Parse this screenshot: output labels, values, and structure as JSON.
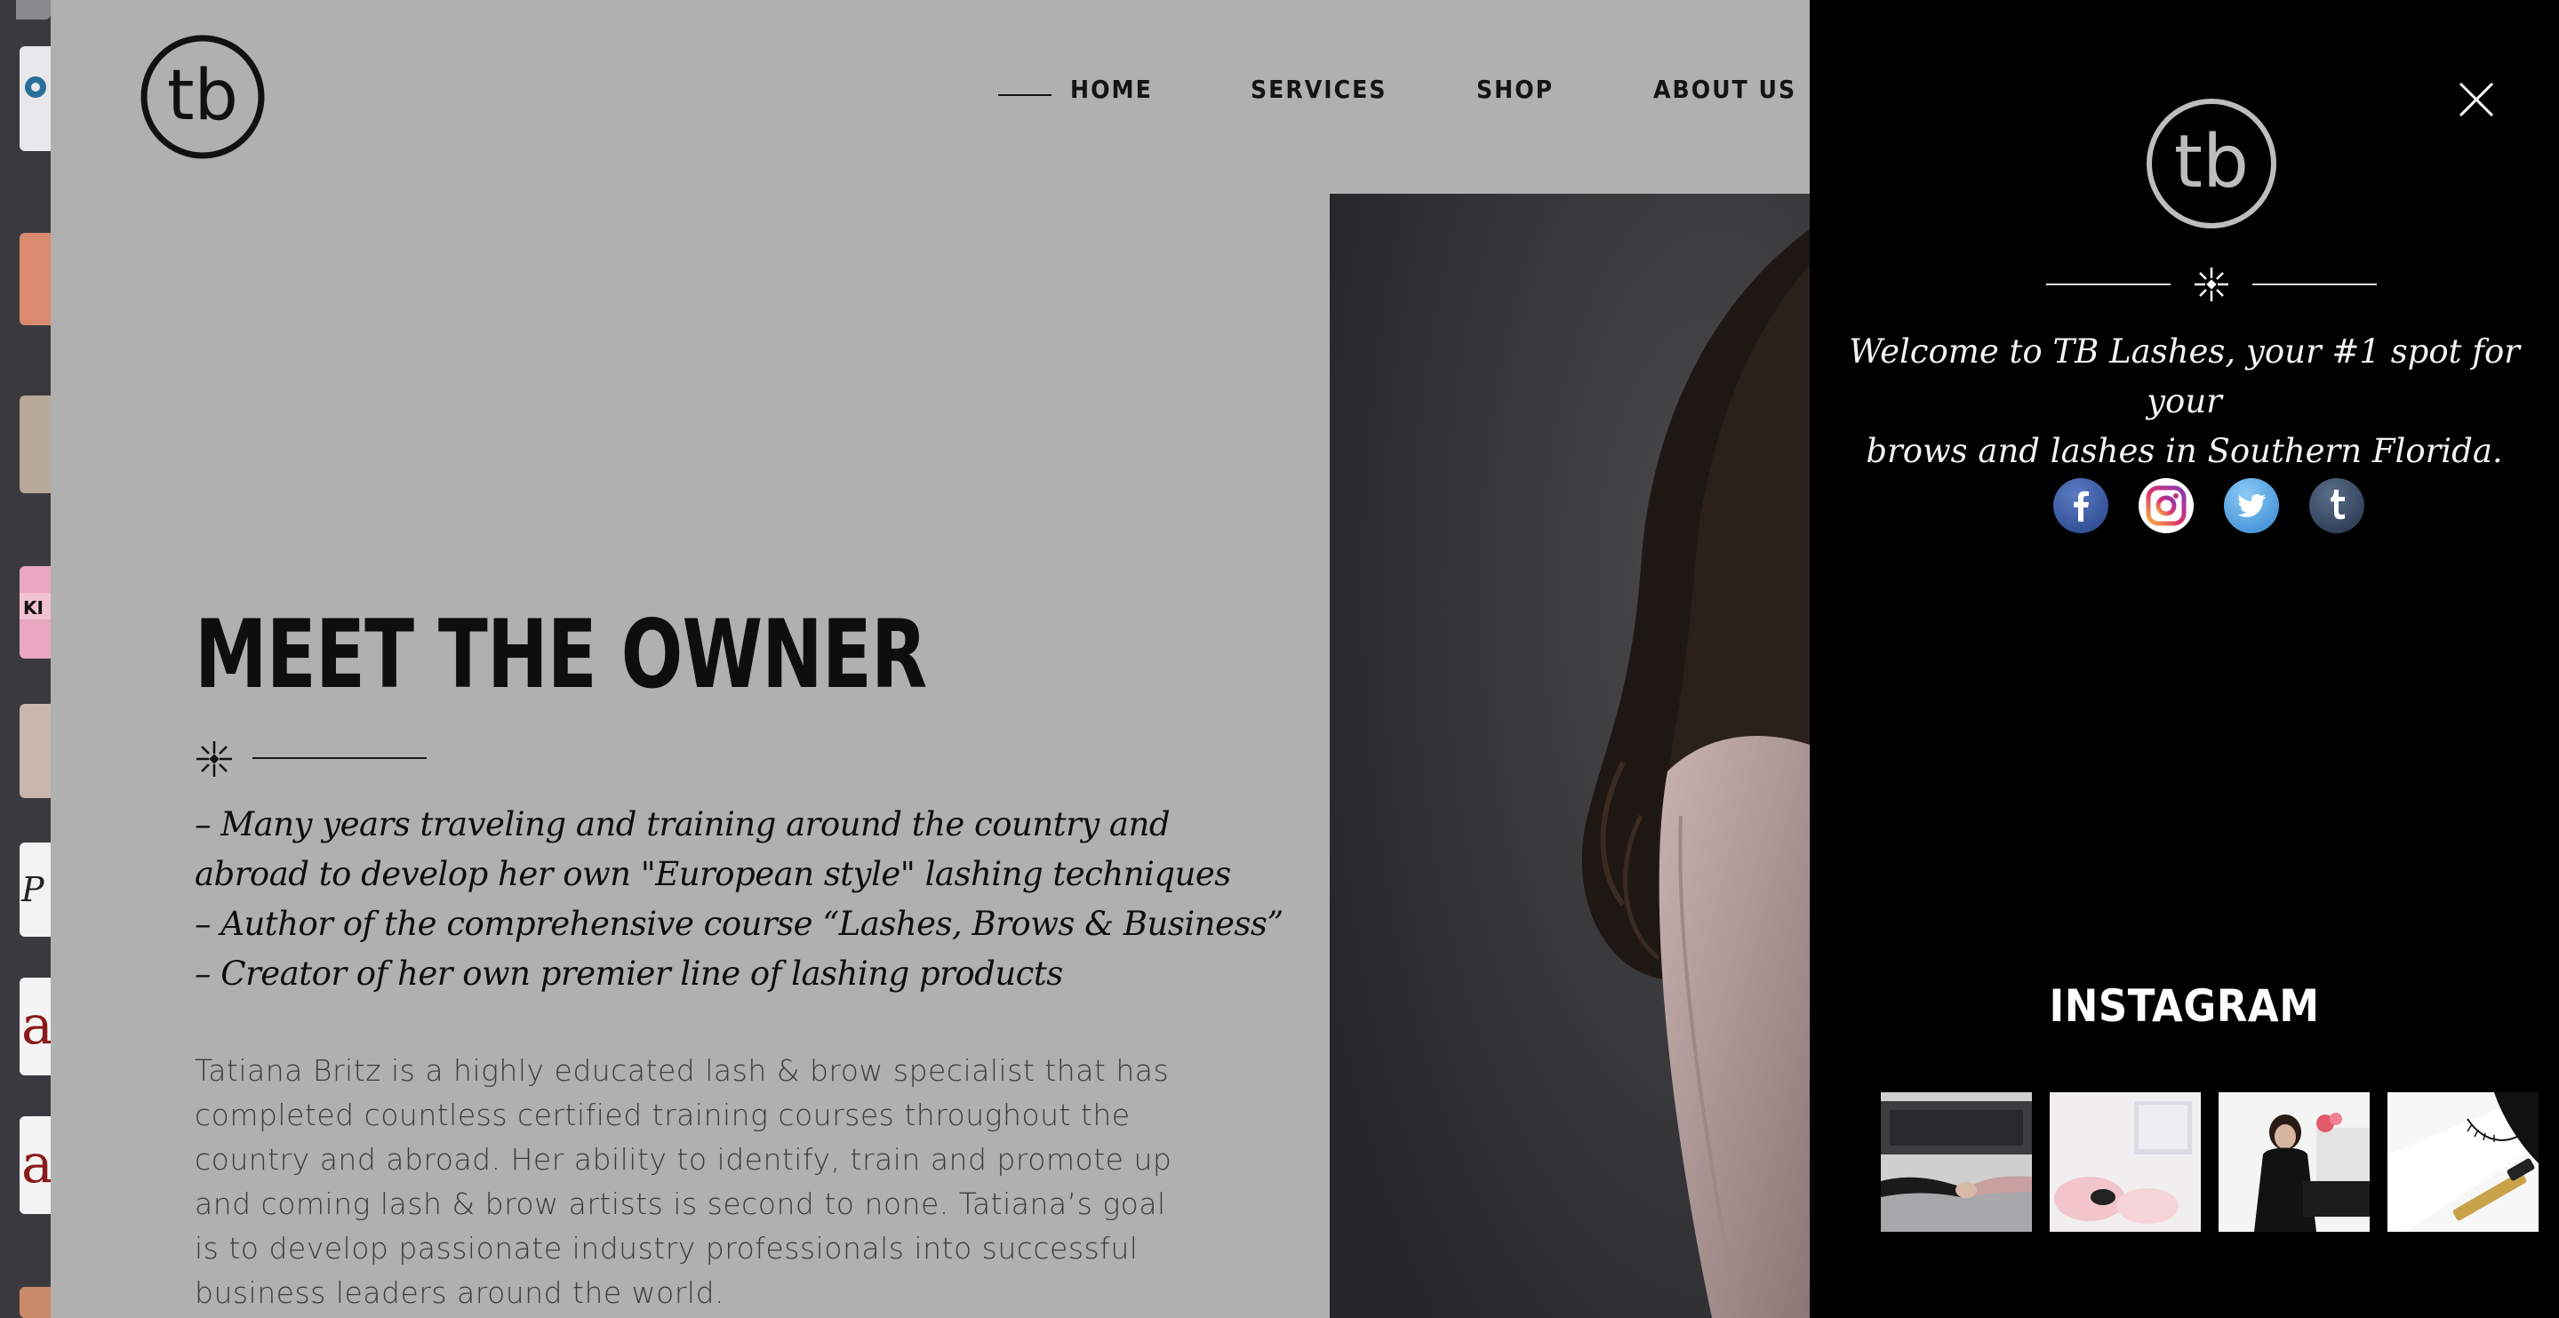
{
  "nav": {
    "items": [
      "HOME",
      "SERVICES",
      "SHOP",
      "ABOUT US"
    ]
  },
  "main": {
    "heading": "MEET THE OWNER",
    "bullets": [
      "– Many years traveling and training around the country and",
      "abroad to develop her own \"European style\" lashing techniques",
      "– Author of the comprehensive course “Lashes, Brows & Business”",
      "– Creator of her own premier line of lashing products"
    ],
    "bio_lines": [
      "Tatiana Britz is a highly educated lash & brow specialist that has",
      "completed countless certified training courses throughout the",
      "country and abroad. Her ability to identify, train and promote up",
      "and coming lash & brow artists is second to none. Tatiana’s goal",
      "is to develop passionate industry professionals into successful",
      "business leaders around the world."
    ]
  },
  "logo_text": "tb",
  "panel": {
    "welcome_lines": [
      "Welcome to TB Lashes, your #1 spot for your",
      "brows and lashes in Southern Florida."
    ],
    "socials": [
      "facebook-icon",
      "instagram-icon",
      "twitter-icon",
      "tumblr-icon"
    ],
    "instagram_title": "INSTAGRAM"
  },
  "colors": {
    "page_bg": "#b0b0b0",
    "panel_bg": "#000000",
    "text_dark": "#0e0e0e",
    "facebook": "#3b5998",
    "twitter": "#55acee",
    "tumblr": "#35465c"
  }
}
